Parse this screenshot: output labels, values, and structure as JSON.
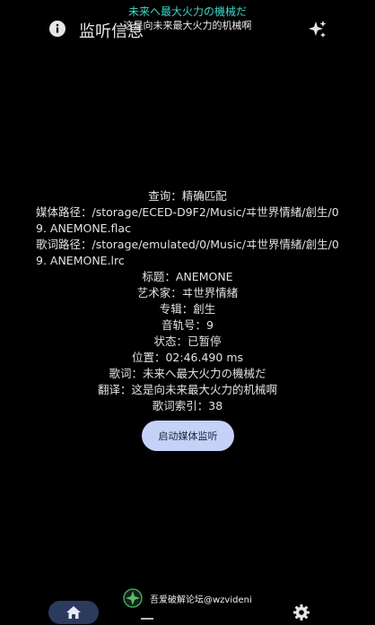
{
  "lyric_overlay": {
    "line1": "未来へ最大火力の機械だ",
    "line2": "这是向未来最大火力的机械啊"
  },
  "header": {
    "title": "监听信息"
  },
  "info": {
    "query": "查询：精确匹配",
    "media_path": "媒体路径：/storage/ECED-D9F2/Music/ヰ世界情緒/創生/09. ANEMONE.flac",
    "lyric_path": "歌词路径：/storage/emulated/0/Music/ヰ世界情緒/創生/09. ANEMONE.lrc",
    "title": "标题：ANEMONE",
    "artist": "艺术家：ヰ世界情緒",
    "album": "专辑：創生",
    "track": "音轨号：9",
    "status": "状态：已暂停",
    "position": "位置：02:46.490 ms",
    "lyric": "歌词：未来へ最大火力の機械だ",
    "translation": "翻译：这是向未来最大火力的机械啊",
    "lyric_index": "歌词索引：38"
  },
  "actions": {
    "start_label": "启动媒体监听"
  },
  "watermark": {
    "text": "吾爱破解论坛@wzvideni"
  },
  "colors": {
    "background": "#000000",
    "accent_lyric": "#3fd6c8",
    "button_bg": "#c5d1f7",
    "nav_active_bg": "#2c3a5e"
  },
  "icons": {
    "header_left": "info-icon",
    "header_right": "sparkle-icon",
    "nav_home": "home-icon",
    "nav_settings": "gear-icon"
  }
}
